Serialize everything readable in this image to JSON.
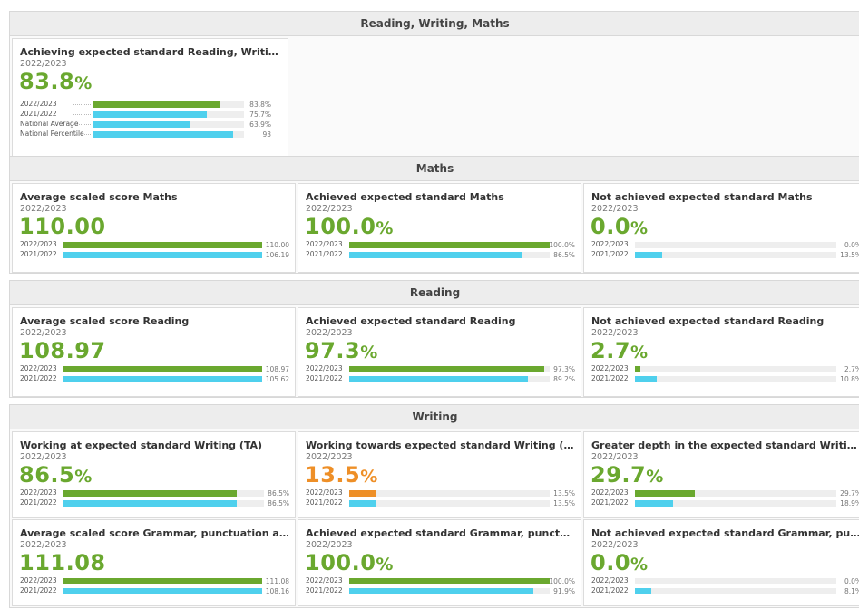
{
  "sections": [
    {
      "title": "Reading, Writing, Maths",
      "cards": [
        {
          "title": "Achieving expected standard Reading, Writing, Maths (...",
          "year": "2022/2023",
          "value": "83.8",
          "unit": "%",
          "style": "green",
          "bars": [
            {
              "label": "2022/2023",
              "value_text": "83.8%",
              "fraction": 0.838,
              "color": "green"
            },
            {
              "label": "2021/2022",
              "value_text": "75.7%",
              "fraction": 0.757,
              "color": "cyan"
            },
            {
              "label": "National Average",
              "value_text": "63.9%",
              "fraction": 0.639,
              "color": "cyan"
            },
            {
              "label": "National Percentile",
              "value_text": "93",
              "fraction": 0.93,
              "color": "cyan"
            }
          ]
        }
      ]
    },
    {
      "title": "Maths",
      "cards": [
        {
          "title": "Average scaled score Maths",
          "year": "2022/2023",
          "value": "110.00",
          "unit": "",
          "style": "green",
          "bars": [
            {
              "label": "2022/2023",
              "value_text": "110.00",
              "fraction": 1.0,
              "color": "green"
            },
            {
              "label": "2021/2022",
              "value_text": "106.19",
              "fraction": 1.0,
              "color": "cyan"
            }
          ]
        },
        {
          "title": "Achieved expected standard Maths",
          "year": "2022/2023",
          "value": "100.0",
          "unit": "%",
          "style": "green",
          "bars": [
            {
              "label": "2022/2023",
              "value_text": "100.0%",
              "fraction": 1.0,
              "color": "green"
            },
            {
              "label": "2021/2022",
              "value_text": "86.5%",
              "fraction": 0.865,
              "color": "cyan"
            }
          ]
        },
        {
          "title": "Not achieved expected standard Maths",
          "year": "2022/2023",
          "value": "0.0",
          "unit": "%",
          "style": "green",
          "bars": [
            {
              "label": "2022/2023",
              "value_text": "0.0%",
              "fraction": 0.0,
              "color": "green"
            },
            {
              "label": "2021/2022",
              "value_text": "13.5%",
              "fraction": 0.135,
              "color": "cyan"
            }
          ]
        }
      ]
    },
    {
      "title": "Reading",
      "cards": [
        {
          "title": "Average scaled score Reading",
          "year": "2022/2023",
          "value": "108.97",
          "unit": "",
          "style": "green",
          "bars": [
            {
              "label": "2022/2023",
              "value_text": "108.97",
              "fraction": 1.0,
              "color": "green"
            },
            {
              "label": "2021/2022",
              "value_text": "105.62",
              "fraction": 1.0,
              "color": "cyan"
            }
          ]
        },
        {
          "title": "Achieved expected standard Reading",
          "year": "2022/2023",
          "value": "97.3",
          "unit": "%",
          "style": "green",
          "bars": [
            {
              "label": "2022/2023",
              "value_text": "97.3%",
              "fraction": 0.973,
              "color": "green"
            },
            {
              "label": "2021/2022",
              "value_text": "89.2%",
              "fraction": 0.892,
              "color": "cyan"
            }
          ]
        },
        {
          "title": "Not achieved expected standard Reading",
          "year": "2022/2023",
          "value": "2.7",
          "unit": "%",
          "style": "green",
          "bars": [
            {
              "label": "2022/2023",
              "value_text": "2.7%",
              "fraction": 0.027,
              "color": "green"
            },
            {
              "label": "2021/2022",
              "value_text": "10.8%",
              "fraction": 0.108,
              "color": "cyan"
            }
          ]
        }
      ]
    },
    {
      "title": "Writing",
      "cards": [
        {
          "title": "Working at expected standard Writing (TA)",
          "year": "2022/2023",
          "value": "86.5",
          "unit": "%",
          "style": "green",
          "bars": [
            {
              "label": "2022/2023",
              "value_text": "86.5%",
              "fraction": 0.865,
              "color": "green"
            },
            {
              "label": "2021/2022",
              "value_text": "86.5%",
              "fraction": 0.865,
              "color": "cyan"
            }
          ]
        },
        {
          "title": "Working towards expected standard Writing (TA)",
          "year": "2022/2023",
          "value": "13.5",
          "unit": "%",
          "style": "orange",
          "bars": [
            {
              "label": "2022/2023",
              "value_text": "13.5%",
              "fraction": 0.135,
              "color": "orange"
            },
            {
              "label": "2021/2022",
              "value_text": "13.5%",
              "fraction": 0.135,
              "color": "cyan"
            }
          ]
        },
        {
          "title": "Greater depth in the expected standard Writing (TA)",
          "year": "2022/2023",
          "value": "29.7",
          "unit": "%",
          "style": "green",
          "bars": [
            {
              "label": "2022/2023",
              "value_text": "29.7%",
              "fraction": 0.297,
              "color": "green"
            },
            {
              "label": "2021/2022",
              "value_text": "18.9%",
              "fraction": 0.189,
              "color": "cyan"
            }
          ]
        },
        {
          "title": "Average scaled score Grammar, punctuation and spelling",
          "year": "2022/2023",
          "value": "111.08",
          "unit": "",
          "style": "green",
          "bars": [
            {
              "label": "2022/2023",
              "value_text": "111.08",
              "fraction": 1.0,
              "color": "green"
            },
            {
              "label": "2021/2022",
              "value_text": "108.16",
              "fraction": 1.0,
              "color": "cyan"
            }
          ]
        },
        {
          "title": "Achieved expected standard Grammar, punctuation and...",
          "year": "2022/2023",
          "value": "100.0",
          "unit": "%",
          "style": "green",
          "bars": [
            {
              "label": "2022/2023",
              "value_text": "100.0%",
              "fraction": 1.0,
              "color": "green"
            },
            {
              "label": "2021/2022",
              "value_text": "91.9%",
              "fraction": 0.919,
              "color": "cyan"
            }
          ]
        },
        {
          "title": "Not achieved expected standard Grammar, punctuation...",
          "year": "2022/2023",
          "value": "0.0",
          "unit": "%",
          "style": "green",
          "bars": [
            {
              "label": "2022/2023",
              "value_text": "0.0%",
              "fraction": 0.0,
              "color": "green"
            },
            {
              "label": "2021/2022",
              "value_text": "8.1%",
              "fraction": 0.081,
              "color": "cyan"
            }
          ]
        }
      ]
    }
  ],
  "colors": {
    "green": "#6aa82f",
    "cyan": "#4fd0ed",
    "orange": "#ee8f27"
  }
}
